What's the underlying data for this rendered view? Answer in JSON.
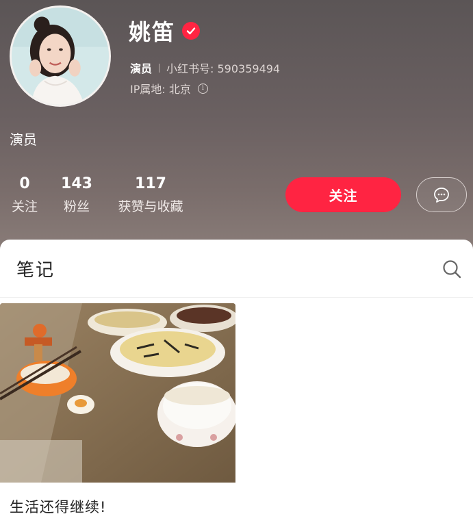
{
  "profile": {
    "name": "姚笛",
    "role": "演员",
    "id_label": "小红书号: 590359494",
    "ip_label": "IP属地: 北京",
    "bio": "演员"
  },
  "stats": [
    {
      "value": "0",
      "label": "关注"
    },
    {
      "value": "143",
      "label": "粉丝"
    },
    {
      "value": "117",
      "label": "获赞与收藏"
    }
  ],
  "actions": {
    "follow_label": "关注"
  },
  "tabs": {
    "notes_label": "笔记"
  },
  "notes": [
    {
      "title": "生活还得继续!"
    }
  ],
  "icons": {
    "verified": "verified-badge-icon",
    "info": "info-icon",
    "message": "chat-bubble-icon",
    "search": "search-icon"
  },
  "colors": {
    "accent": "#ff2442",
    "header_bg": "#6a6061"
  }
}
